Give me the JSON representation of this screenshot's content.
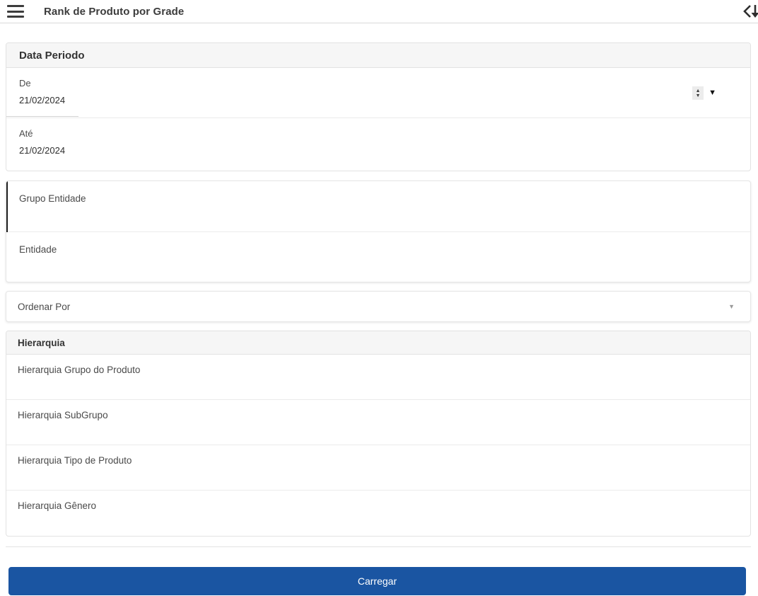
{
  "topbar": {
    "title": "Rank de Produto por Grade"
  },
  "form": {
    "data_periodo": {
      "header": "Data Periodo",
      "de": {
        "label": "De",
        "value": "21/02/2024"
      },
      "ate": {
        "label": "Até",
        "value": "21/02/2024"
      }
    },
    "grupo_entidade_label": "Grupo Entidade",
    "entidade_label": "Entidade",
    "ordenar_por_label": "Ordenar Por",
    "ordenar_por_value": "",
    "hierarquia": {
      "header": "Hierarquia",
      "items": [
        "Hierarquia Grupo do Produto",
        "Hierarquia SubGrupo",
        "Hierarquia Tipo de Produto",
        "Hierarquia Gênero"
      ]
    },
    "submit_label": "Carregar"
  },
  "glyphs": {
    "spinner_up": "▲",
    "spinner_down": "▼",
    "caret_down_black": "▼",
    "caret_down_gray": "▼"
  },
  "colors": {
    "accent_blue": "#1a55a2",
    "section_header_bg": "#f6f6f6",
    "border": "#e2e2e2",
    "focused_row_border": "#1f1f1f"
  }
}
